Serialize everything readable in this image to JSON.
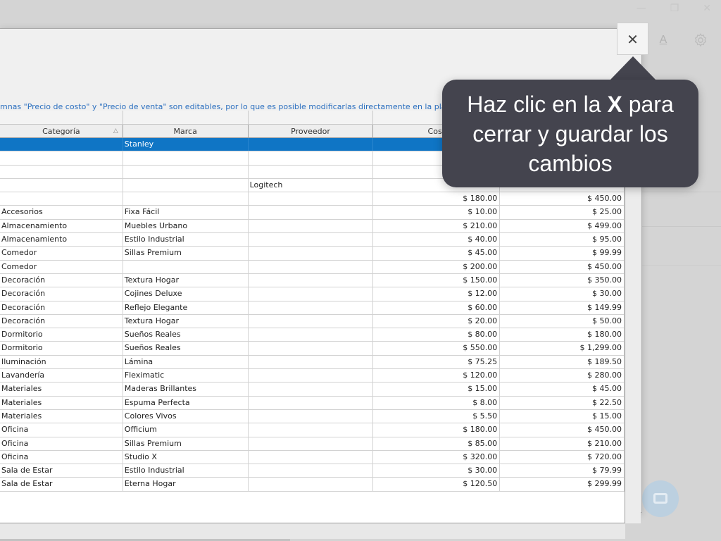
{
  "tooltip": {
    "line1_pre": "Haz clic en la ",
    "line1_key": "X",
    "line1_post": " para",
    "line2": "cerrar y guardar los",
    "line3": "cambios"
  },
  "dialog": {
    "close_label": "✕",
    "hint": "mnas \"Precio de costo\" y \"Precio de venta\" son editables, por lo que es posible modificarlas directamente en la planil"
  },
  "background": {
    "font_button_label": "A",
    "window_controls": [
      "—",
      "❐",
      "✕"
    ]
  },
  "table": {
    "columns": [
      "Categoría",
      "Marca",
      "Proveedor",
      "Cost",
      ""
    ],
    "rows": [
      {
        "categoria": "",
        "marca": "Stanley",
        "proveedor": "",
        "costo": "",
        "venta": "",
        "selected": true
      },
      {
        "categoria": "",
        "marca": "",
        "proveedor": "",
        "costo": "",
        "venta": ""
      },
      {
        "categoria": "",
        "marca": "",
        "proveedor": "",
        "costo": "",
        "venta": ""
      },
      {
        "categoria": "",
        "marca": "",
        "proveedor": "Logitech",
        "costo": "",
        "venta": ""
      },
      {
        "categoria": "",
        "marca": "",
        "proveedor": "",
        "costo": "$ 180.00",
        "venta": "$ 450.00"
      },
      {
        "categoria": "Accesorios",
        "marca": "Fixa Fácil",
        "proveedor": "",
        "costo": "$ 10.00",
        "venta": "$ 25.00"
      },
      {
        "categoria": "Almacenamiento",
        "marca": "Muebles Urbano",
        "proveedor": "",
        "costo": "$ 210.00",
        "venta": "$ 499.00"
      },
      {
        "categoria": "Almacenamiento",
        "marca": "Estilo Industrial",
        "proveedor": "",
        "costo": "$ 40.00",
        "venta": "$ 95.00"
      },
      {
        "categoria": "Comedor",
        "marca": "Sillas Premium",
        "proveedor": "",
        "costo": "$ 45.00",
        "venta": "$ 99.99"
      },
      {
        "categoria": "Comedor",
        "marca": "",
        "proveedor": "",
        "costo": "$ 200.00",
        "venta": "$ 450.00"
      },
      {
        "categoria": "Decoración",
        "marca": "Textura Hogar",
        "proveedor": "",
        "costo": "$ 150.00",
        "venta": "$ 350.00"
      },
      {
        "categoria": "Decoración",
        "marca": "Cojines Deluxe",
        "proveedor": "",
        "costo": "$ 12.00",
        "venta": "$ 30.00"
      },
      {
        "categoria": "Decoración",
        "marca": "Reflejo Elegante",
        "proveedor": "",
        "costo": "$ 60.00",
        "venta": "$ 149.99"
      },
      {
        "categoria": "Decoración",
        "marca": "Textura Hogar",
        "proveedor": "",
        "costo": "$ 20.00",
        "venta": "$ 50.00"
      },
      {
        "categoria": "Dormitorio",
        "marca": "Sueños Reales",
        "proveedor": "",
        "costo": "$ 80.00",
        "venta": "$ 180.00"
      },
      {
        "categoria": "Dormitorio",
        "marca": "Sueños Reales",
        "proveedor": "",
        "costo": "$ 550.00",
        "venta": "$ 1,299.00"
      },
      {
        "categoria": "Iluminación",
        "marca": "Lámina",
        "proveedor": "",
        "costo": "$ 75.25",
        "venta": "$ 189.50"
      },
      {
        "categoria": "Lavandería",
        "marca": "Fleximatic",
        "proveedor": "",
        "costo": "$ 120.00",
        "venta": "$ 280.00"
      },
      {
        "categoria": "Materiales",
        "marca": "Maderas Brillantes",
        "proveedor": "",
        "costo": "$ 15.00",
        "venta": "$ 45.00"
      },
      {
        "categoria": "Materiales",
        "marca": "Espuma Perfecta",
        "proveedor": "",
        "costo": "$ 8.00",
        "venta": "$ 22.50"
      },
      {
        "categoria": "Materiales",
        "marca": "Colores Vivos",
        "proveedor": "",
        "costo": "$ 5.50",
        "venta": "$ 15.00"
      },
      {
        "categoria": "Oficina",
        "marca": "Officium",
        "proveedor": "",
        "costo": "$ 180.00",
        "venta": "$ 450.00"
      },
      {
        "categoria": "Oficina",
        "marca": "Sillas Premium",
        "proveedor": "",
        "costo": "$ 85.00",
        "venta": "$ 210.00"
      },
      {
        "categoria": "Oficina",
        "marca": "Studio X",
        "proveedor": "",
        "costo": "$ 320.00",
        "venta": "$ 720.00"
      },
      {
        "categoria": "Sala de Estar",
        "marca": "Estilo Industrial",
        "proveedor": "",
        "costo": "$ 30.00",
        "venta": "$ 79.99"
      },
      {
        "categoria": "Sala de Estar",
        "marca": "Eterna Hogar",
        "proveedor": "",
        "costo": "$ 120.50",
        "venta": "$ 299.99"
      }
    ]
  }
}
